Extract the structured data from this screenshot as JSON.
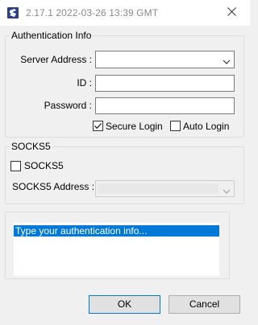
{
  "window": {
    "title": "2.17.1 2022-03-26 13:39 GMT",
    "close_icon": "close-icon",
    "app_icon": "app-logo-icon"
  },
  "auth_group": {
    "title": "Authentication Info",
    "server_label": "Server Address :",
    "server_value": "",
    "id_label": "ID :",
    "id_value": "",
    "password_label": "Password :",
    "password_value": "",
    "secure_login_label": "Secure Login",
    "secure_login_checked": true,
    "auto_login_label": "Auto Login",
    "auto_login_checked": false
  },
  "socks_group": {
    "title": "SOCKS5",
    "checkbox_label": "SOCKS5",
    "checkbox_checked": false,
    "address_label": "SOCKS5 Address :",
    "address_value": ""
  },
  "info": {
    "text": "Type your authentication info..."
  },
  "buttons": {
    "ok": "OK",
    "cancel": "Cancel"
  },
  "colors": {
    "accent": "#0078d7",
    "window_bg": "#f0f0f0"
  }
}
